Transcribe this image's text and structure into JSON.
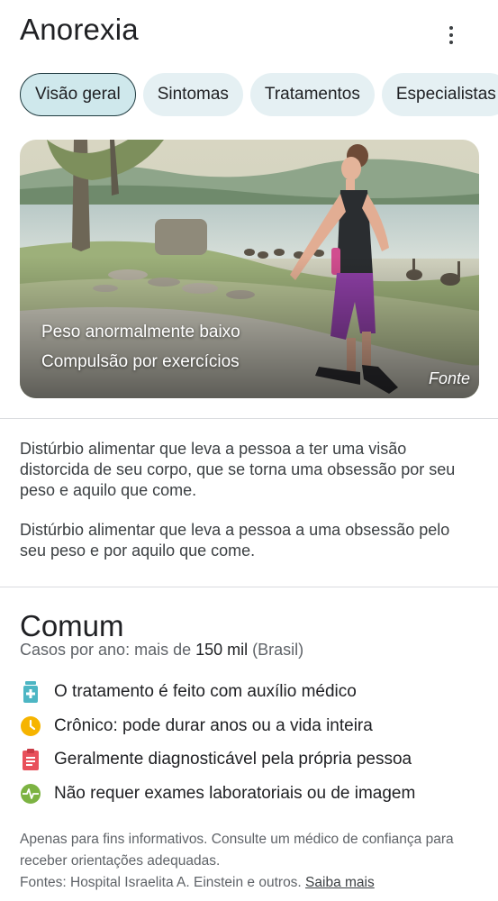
{
  "header": {
    "title": "Anorexia"
  },
  "tabs": [
    {
      "label": "Visão geral",
      "active": true
    },
    {
      "label": "Sintomas",
      "active": false
    },
    {
      "label": "Tratamentos",
      "active": false
    },
    {
      "label": "Especialistas",
      "active": false
    }
  ],
  "hero": {
    "captions": [
      "Peso anormalmente baixo",
      "Compulsão por exercícios"
    ],
    "source_label": "Fonte"
  },
  "descriptions": [
    "Distúrbio alimentar que leva a pessoa a ter uma visão distorcida de seu corpo, que se torna uma obsessão por seu peso e aquilo que come.",
    "Distúrbio alimentar que leva a pessoa a uma obsessão pelo seu peso e por aquilo que come."
  ],
  "prevalence": {
    "title": "Comum",
    "cases_prefix": "Casos por ano: mais de ",
    "cases_value": "150 mil",
    "cases_suffix": " (Brasil)"
  },
  "facts": [
    {
      "icon": "medicine-bottle-icon",
      "color": "#4db6c4",
      "text": "O tratamento é feito com auxílio médico"
    },
    {
      "icon": "clock-icon",
      "color": "#f6b400",
      "text": "Crônico: pode durar anos ou a vida inteira"
    },
    {
      "icon": "clipboard-icon",
      "color": "#e8505b",
      "text": "Geralmente diagnosticável pela própria pessoa"
    },
    {
      "icon": "pulse-icon",
      "color": "#7cb342",
      "text": "Não requer exames laboratoriais ou de imagem"
    }
  ],
  "footer": {
    "disclaimer": "Apenas para fins informativos. Consulte um médico de confiança para receber orientações adequadas.",
    "sources_prefix": "Fontes: Hospital Israelita A. Einstein e outros. ",
    "learn_more": "Saiba mais"
  }
}
